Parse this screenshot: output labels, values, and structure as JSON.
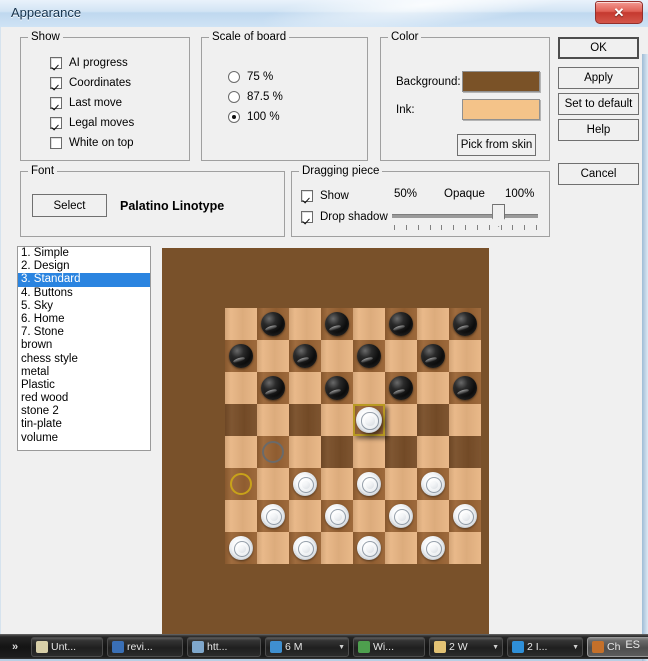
{
  "window": {
    "title": "Appearance",
    "close_icon": "close-icon",
    "close_glyph": "✕"
  },
  "show_group": {
    "legend": "Show",
    "items": [
      {
        "label": "AI progress",
        "checked": true
      },
      {
        "label": "Coordinates",
        "checked": true
      },
      {
        "label": "Last move",
        "checked": true
      },
      {
        "label": "Legal moves",
        "checked": true
      },
      {
        "label": "White on top",
        "checked": false
      }
    ]
  },
  "scale_group": {
    "legend": "Scale of board",
    "options": [
      {
        "label": "75 %",
        "selected": false
      },
      {
        "label": "87.5 %",
        "selected": false
      },
      {
        "label": "100 %",
        "selected": true
      }
    ]
  },
  "color_group": {
    "legend": "Color",
    "background_label": "Background:",
    "background_color": "#7a5227",
    "ink_label": "Ink:",
    "ink_color": "#f4c389",
    "pick_button": "Pick from skin"
  },
  "font_group": {
    "legend": "Font",
    "select_button": "Select",
    "font_name": "Palatino Linotype"
  },
  "dragging_group": {
    "legend": "Dragging piece",
    "show": {
      "label": "Show",
      "checked": true
    },
    "drop_shadow": {
      "label": "Drop shadow",
      "checked": true
    },
    "slider": {
      "min_label": "50%",
      "center_label": "Opaque",
      "max_label": "100%",
      "value_percent": 72
    }
  },
  "buttons": {
    "ok": "OK",
    "apply": "Apply",
    "set_to_default": "Set to default",
    "help": "Help",
    "cancel": "Cancel"
  },
  "skin_list": {
    "items": [
      {
        "label": "1. Simple",
        "selected": false
      },
      {
        "label": "2. Design",
        "selected": false
      },
      {
        "label": "3. Standard",
        "selected": true
      },
      {
        "label": "4. Buttons",
        "selected": false
      },
      {
        "label": "5. Sky",
        "selected": false
      },
      {
        "label": "6. Home",
        "selected": false
      },
      {
        "label": "7. Stone",
        "selected": false
      },
      {
        "label": "brown",
        "selected": false
      },
      {
        "label": "chess style",
        "selected": false
      },
      {
        "label": "metal",
        "selected": false
      },
      {
        "label": "Plastic",
        "selected": false
      },
      {
        "label": "red wood",
        "selected": false
      },
      {
        "label": "stone 2",
        "selected": false
      },
      {
        "label": "tin-plate",
        "selected": false
      },
      {
        "label": "volume",
        "selected": false
      }
    ]
  },
  "preview": {
    "background_color": "#79512a",
    "light_square_color": "#e8b583",
    "dark_square_color": "#9a6434",
    "board_columns": 8,
    "board_rows": 8,
    "pieces": [
      {
        "col": 1,
        "row": 0,
        "color": "black"
      },
      {
        "col": 3,
        "row": 0,
        "color": "black"
      },
      {
        "col": 5,
        "row": 0,
        "color": "black"
      },
      {
        "col": 7,
        "row": 0,
        "color": "black"
      },
      {
        "col": 0,
        "row": 1,
        "color": "black"
      },
      {
        "col": 2,
        "row": 1,
        "color": "black"
      },
      {
        "col": 4,
        "row": 1,
        "color": "black"
      },
      {
        "col": 6,
        "row": 1,
        "color": "black"
      },
      {
        "col": 1,
        "row": 2,
        "color": "black"
      },
      {
        "col": 3,
        "row": 2,
        "color": "black"
      },
      {
        "col": 5,
        "row": 2,
        "color": "black"
      },
      {
        "col": 7,
        "row": 2,
        "color": "black"
      },
      {
        "col": 2,
        "row": 5,
        "color": "white"
      },
      {
        "col": 4,
        "row": 5,
        "color": "white"
      },
      {
        "col": 6,
        "row": 5,
        "color": "white"
      },
      {
        "col": 1,
        "row": 6,
        "color": "white"
      },
      {
        "col": 3,
        "row": 6,
        "color": "white"
      },
      {
        "col": 5,
        "row": 6,
        "color": "white"
      },
      {
        "col": 7,
        "row": 6,
        "color": "white"
      },
      {
        "col": 0,
        "row": 7,
        "color": "white"
      },
      {
        "col": 2,
        "row": 7,
        "color": "white"
      },
      {
        "col": 4,
        "row": 7,
        "color": "white"
      },
      {
        "col": 6,
        "row": 7,
        "color": "white"
      }
    ],
    "markers": [
      {
        "col": 1,
        "row": 4,
        "style": "gray"
      },
      {
        "col": 0,
        "row": 5,
        "style": "gold"
      }
    ],
    "dragging_piece": {
      "col": 4,
      "row": 3,
      "color": "white",
      "highlight": true
    },
    "shaded_squares": [
      {
        "col": 0,
        "row": 3
      },
      {
        "col": 2,
        "row": 3
      },
      {
        "col": 6,
        "row": 3
      },
      {
        "col": 3,
        "row": 4
      },
      {
        "col": 5,
        "row": 4
      },
      {
        "col": 7,
        "row": 4
      }
    ]
  },
  "taskbar": {
    "overflow_glyph": "»",
    "items": [
      {
        "label": "Unt...",
        "icon_color": "#d8cfa8",
        "has_arrow": false,
        "active": false
      },
      {
        "label": "revi...",
        "icon_color": "#3a6fb5",
        "has_arrow": false,
        "active": false
      },
      {
        "label": "htt...",
        "icon_color": "#7fa7cc",
        "has_arrow": false,
        "active": false
      },
      {
        "label": "6 M",
        "icon_color": "#3f8fd0",
        "has_arrow": true,
        "active": false
      },
      {
        "label": "Wi...",
        "icon_color": "#4e9f4e",
        "has_arrow": false,
        "active": false
      },
      {
        "label": "2 W",
        "icon_color": "#e3c274",
        "has_arrow": true,
        "active": false
      },
      {
        "label": "2 I...",
        "icon_color": "#2f8fd8",
        "has_arrow": true,
        "active": false
      },
      {
        "label": "Ch",
        "icon_color": "#c4702a",
        "has_arrow": false,
        "active": true
      }
    ],
    "language": "ES"
  }
}
